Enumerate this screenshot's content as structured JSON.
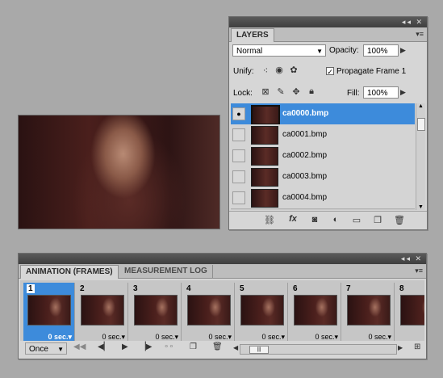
{
  "layers_panel": {
    "tab_label": "LAYERS",
    "blend_mode": "Normal",
    "opacity_label": "Opacity:",
    "opacity_value": "100%",
    "unify_label": "Unify:",
    "propagate_label": "Propagate Frame 1",
    "lock_label": "Lock:",
    "fill_label": "Fill:",
    "fill_value": "100%",
    "layers": [
      {
        "name": "ca0000.bmp",
        "visible": true,
        "selected": true
      },
      {
        "name": "ca0001.bmp",
        "visible": false,
        "selected": false
      },
      {
        "name": "ca0002.bmp",
        "visible": false,
        "selected": false
      },
      {
        "name": "ca0003.bmp",
        "visible": false,
        "selected": false
      },
      {
        "name": "ca0004.bmp",
        "visible": false,
        "selected": false
      }
    ]
  },
  "animation_panel": {
    "tab_active": "ANIMATION (FRAMES)",
    "tab_inactive": "MEASUREMENT LOG",
    "loop_option": "Once",
    "frames": [
      {
        "number": "1",
        "delay": "0 sec."
      },
      {
        "number": "2",
        "delay": "0 sec."
      },
      {
        "number": "3",
        "delay": "0 sec."
      },
      {
        "number": "4",
        "delay": "0 sec."
      },
      {
        "number": "5",
        "delay": "0 sec."
      },
      {
        "number": "6",
        "delay": "0 sec."
      },
      {
        "number": "7",
        "delay": "0 sec."
      },
      {
        "number": "8",
        "delay": ""
      }
    ]
  },
  "colors": {
    "selection_blue": "#3d8bdb",
    "panel_bg": "#d6d6d6",
    "canvas_bg": "#a9a9a9"
  }
}
